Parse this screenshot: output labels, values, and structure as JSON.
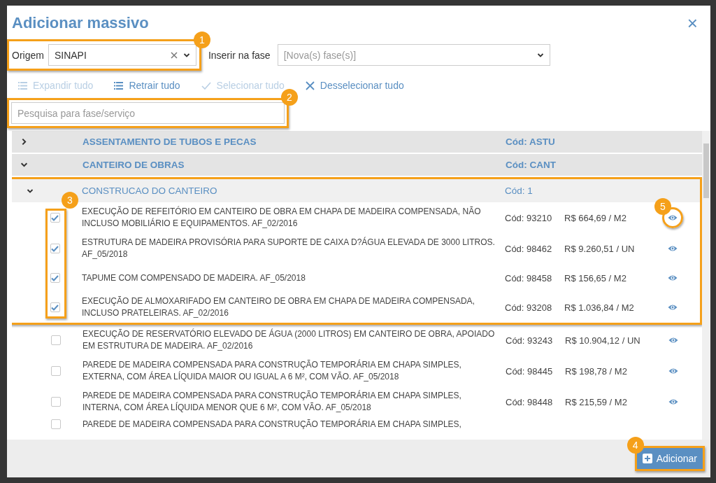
{
  "dialog": {
    "title": "Adicionar massivo",
    "close": "×"
  },
  "origin": {
    "label": "Origem",
    "value": "SINAPI",
    "callout": "1"
  },
  "phase": {
    "label": "Inserir na fase",
    "placeholder": "[Nova(s) fase(s)]"
  },
  "toolbar": [
    {
      "label": "Expandir tudo",
      "kind": "list",
      "disabled": true
    },
    {
      "label": "Retrair tudo",
      "kind": "list",
      "disabled": false
    },
    {
      "label": "Selecionar tudo",
      "kind": "check",
      "disabled": true
    },
    {
      "label": "Desselecionar tudo",
      "kind": "cross",
      "disabled": false
    }
  ],
  "search": {
    "placeholder": "Pesquisa para fase/serviço",
    "callout": "2"
  },
  "tree": [
    {
      "title": "ASSENTAMENTO DE TUBOS E PECAS",
      "code": "Cód: ASTU",
      "expanded": false
    },
    {
      "title": "CANTEIRO DE OBRAS",
      "code": "Cód: CANT",
      "expanded": true,
      "children": [
        {
          "title": "CONSTRUCAO DO CANTEIRO",
          "code": "Cód: 1",
          "expanded": true,
          "callout": "3",
          "framed_items": [
            {
              "description": "EXECUÇÃO DE REFEITÓRIO EM CANTEIRO DE OBRA EM CHAPA DE MADEIRA COMPENSADA, NÃO INCLUSO MOBILIÁRIO E EQUIPAMENTOS. AF_02/2016",
              "code": "Cód: 93210",
              "price": "R$ 664,69 / M2",
              "checked": true,
              "callout": "5"
            },
            {
              "description": "ESTRUTURA DE MADEIRA PROVISÓRIA PARA SUPORTE DE CAIXA D?ÁGUA ELEVADA DE 3000 LITROS. AF_05/2018",
              "code": "Cód: 98462",
              "price": "R$ 9.260,51 / UN",
              "checked": true
            },
            {
              "description": "TAPUME COM COMPENSADO DE MADEIRA. AF_05/2018",
              "code": "Cód: 98458",
              "price": "R$ 156,65 / M2",
              "checked": true
            },
            {
              "description": "EXECUÇÃO DE ALMOXARIFADO EM CANTEIRO DE OBRA EM CHAPA DE MADEIRA COMPENSADA, INCLUSO PRATELEIRAS. AF_02/2016",
              "code": "Cód: 93208",
              "price": "R$ 1.036,84 / M2",
              "checked": true
            }
          ],
          "items": [
            {
              "description": "EXECUÇÃO DE RESERVATÓRIO ELEVADO DE ÁGUA (2000 LITROS) EM CANTEIRO DE OBRA, APOIADO EM ESTRUTURA DE MADEIRA. AF_02/2016",
              "code": "Cód: 93243",
              "price": "R$ 10.904,12 / UN",
              "checked": false
            },
            {
              "description": "PAREDE DE MADEIRA COMPENSADA PARA CONSTRUÇÃO TEMPORÁRIA EM CHAPA SIMPLES, EXTERNA, COM ÁREA LÍQUIDA MAIOR OU IGUAL A 6 M², COM VÃO. AF_05/2018",
              "code": "Cód: 98445",
              "price": "R$ 198,78 / M2",
              "checked": false
            },
            {
              "description": "PAREDE DE MADEIRA COMPENSADA PARA CONSTRUÇÃO TEMPORÁRIA EM CHAPA SIMPLES, INTERNA, COM ÁREA LÍQUIDA MENOR QUE 6 M², COM VÃO. AF_05/2018",
              "code": "Cód: 98448",
              "price": "R$ 215,59 / M2",
              "checked": false
            },
            {
              "description": "PAREDE DE MADEIRA COMPENSADA PARA CONSTRUÇÃO TEMPORÁRIA EM CHAPA SIMPLES,",
              "checked": false
            }
          ]
        }
      ]
    }
  ],
  "add_button": {
    "label": "Adicionar",
    "callout": "4"
  }
}
